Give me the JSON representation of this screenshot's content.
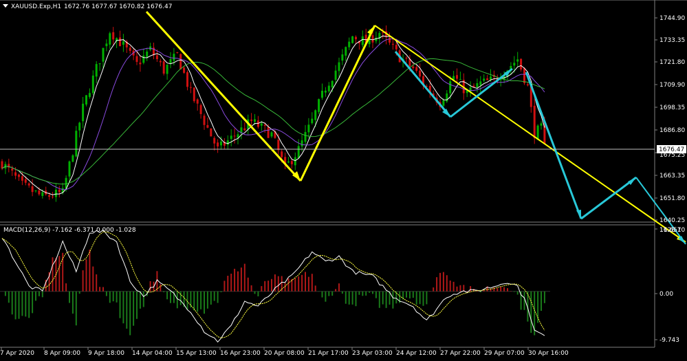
{
  "header": {
    "symbol": "XAUUSD.Exp,H1",
    "ohlc": "1672.76 1677.67 1670.82 1676.47"
  },
  "price_axis": {
    "ticks": [
      "1744.90",
      "1733.35",
      "1721.80",
      "1709.90",
      "1698.35",
      "1686.80",
      "1675.25",
      "1663.35",
      "1651.80",
      "1640.25",
      "1628.70"
    ],
    "current_price": "1676.47"
  },
  "macd_panel": {
    "label": "MACD(12,26,9) -7.162 -6.371 0.000 -1.028",
    "ticks": [
      "11.651",
      "0.00",
      "-9.743"
    ]
  },
  "time_axis": {
    "labels": [
      "7 Apr 2020",
      "8 Apr 09:00",
      "9 Apr 18:00",
      "14 Apr 04:00",
      "15 Apr 13:00",
      "16 Apr 23:00",
      "20 Apr 08:00",
      "21 Apr 17:00",
      "23 Apr 03:00",
      "24 Apr 12:00",
      "27 Apr 22:00",
      "29 Apr 07:00",
      "30 Apr 16:00"
    ]
  },
  "colors": {
    "background": "#000000",
    "bull": "#00b000",
    "bear": "#d01010",
    "ma_fast": "#ffffff",
    "ma_mid": "#8a4be0",
    "ma_slow": "#38b838",
    "trend_yellow": "#ffff00",
    "wave_cyan": "#28c8d8",
    "macd_line": "#ffffff",
    "signal_line": "#ffff40",
    "hist_pos": "#b01818",
    "hist_neg": "#1a7a1a"
  },
  "chart_data": {
    "type": "candlestick",
    "symbol": "XAUUSD",
    "timeframe": "H1",
    "ylim": [
      1637,
      1752
    ],
    "price_path": [
      [
        0,
        1668
      ],
      [
        6,
        1656
      ],
      [
        12,
        1650
      ],
      [
        18,
        1652
      ],
      [
        24,
        1697
      ],
      [
        28,
        1718
      ],
      [
        32,
        1738
      ],
      [
        36,
        1730
      ],
      [
        40,
        1720
      ],
      [
        44,
        1728
      ],
      [
        48,
        1717
      ],
      [
        52,
        1725
      ],
      [
        56,
        1705
      ],
      [
        60,
        1690
      ],
      [
        64,
        1675
      ],
      [
        70,
        1684
      ],
      [
        74,
        1690
      ],
      [
        80,
        1683
      ],
      [
        84,
        1665
      ],
      [
        88,
        1675
      ],
      [
        92,
        1690
      ],
      [
        96,
        1708
      ],
      [
        100,
        1720
      ],
      [
        104,
        1735
      ],
      [
        108,
        1732
      ],
      [
        112,
        1737
      ],
      [
        118,
        1724
      ],
      [
        122,
        1718
      ],
      [
        126,
        1708
      ],
      [
        130,
        1700
      ],
      [
        134,
        1714
      ],
      [
        138,
        1705
      ],
      [
        142,
        1710
      ],
      [
        146,
        1712
      ],
      [
        150,
        1718
      ],
      [
        153,
        1723
      ],
      [
        156,
        1708
      ],
      [
        158,
        1684
      ],
      [
        160,
        1686
      ],
      [
        161,
        1676
      ]
    ],
    "macd": {
      "ylim": [
        -11,
        13
      ],
      "path": [
        [
          0,
          11
        ],
        [
          8,
          1
        ],
        [
          12,
          0
        ],
        [
          18,
          10
        ],
        [
          22,
          4
        ],
        [
          26,
          12
        ],
        [
          30,
          12
        ],
        [
          34,
          10
        ],
        [
          38,
          2
        ],
        [
          42,
          -1
        ],
        [
          46,
          2
        ],
        [
          50,
          0
        ],
        [
          56,
          -4
        ],
        [
          60,
          -8
        ],
        [
          64,
          -10
        ],
        [
          68,
          -7
        ],
        [
          72,
          -2
        ],
        [
          76,
          -3
        ],
        [
          82,
          1
        ],
        [
          86,
          3
        ],
        [
          92,
          8
        ],
        [
          96,
          6
        ],
        [
          100,
          7
        ],
        [
          104,
          4
        ],
        [
          110,
          3
        ],
        [
          116,
          -1
        ],
        [
          122,
          -3
        ],
        [
          126,
          -6
        ],
        [
          132,
          -1
        ],
        [
          136,
          0
        ],
        [
          140,
          0
        ],
        [
          146,
          1
        ],
        [
          150,
          2
        ],
        [
          153,
          1
        ],
        [
          156,
          -3
        ],
        [
          158,
          -8
        ],
        [
          161,
          -9
        ]
      ]
    }
  }
}
